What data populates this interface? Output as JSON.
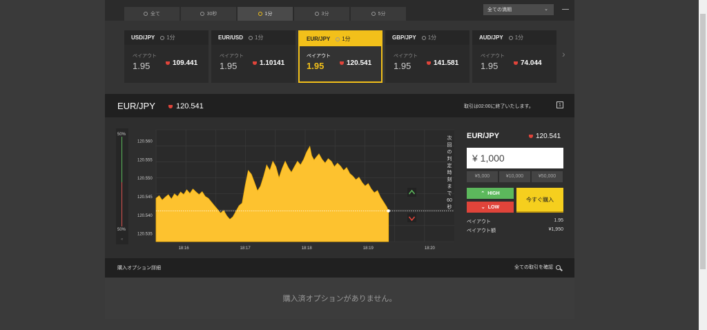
{
  "tabs": [
    {
      "label": "全て",
      "active": false
    },
    {
      "label": "30秒",
      "active": false
    },
    {
      "label": "1分",
      "active": true
    },
    {
      "label": "3分",
      "active": false
    },
    {
      "label": "5分",
      "active": false
    }
  ],
  "account_select": "全ての満期",
  "cards": [
    {
      "pair": "USD/JPY",
      "duration": "1分",
      "payout_label": "ペイアウト",
      "payout": "1.95",
      "price": "109.441"
    },
    {
      "pair": "EUR/USD",
      "duration": "1分",
      "payout_label": "ペイアウト",
      "payout": "1.95",
      "price": "1.10141"
    },
    {
      "pair": "EUR/JPY",
      "duration": "1分",
      "payout_label": "ペイアウト",
      "payout": "1.95",
      "price": "120.541"
    },
    {
      "pair": "GBP/JPY",
      "duration": "1分",
      "payout_label": "ペイアウト",
      "payout": "1.95",
      "price": "141.581"
    },
    {
      "pair": "AUD/JPY",
      "duration": "1分",
      "payout_label": "ペイアウト",
      "payout": "1.95",
      "price": "74.044"
    }
  ],
  "pairbar": {
    "name": "EUR/JPY",
    "price": "120.541",
    "end_message": "取引は02:00に終了いたします。",
    "cal_icon": "1"
  },
  "gauge": {
    "top": "50%",
    "bottom": "50%",
    "reset": "«"
  },
  "chart_data": {
    "type": "area",
    "y_ticks": [
      "120.560",
      "120.555",
      "120.550",
      "120.545",
      "120.540",
      "120.535"
    ],
    "y_values": [
      120.56,
      120.555,
      120.55,
      120.545,
      120.54,
      120.535
    ],
    "ylim": [
      120.5328,
      120.563
    ],
    "x_ticks": [
      "18:16",
      "18:17",
      "18:18",
      "18:19",
      "18:20"
    ],
    "x_tick_min": [
      16,
      17,
      18,
      19,
      20
    ],
    "xlim": [
      15.55,
      20.4
    ],
    "series": [
      {
        "values": [
          [
            15.55,
            120.5445
          ],
          [
            15.6,
            120.5452
          ],
          [
            15.65,
            120.544
          ],
          [
            15.7,
            120.5448
          ],
          [
            15.75,
            120.5455
          ],
          [
            15.8,
            120.5443
          ],
          [
            15.85,
            120.5457
          ],
          [
            15.9,
            120.545
          ],
          [
            15.95,
            120.5462
          ],
          [
            16.0,
            120.5455
          ],
          [
            16.05,
            120.5468
          ],
          [
            16.1,
            120.5458
          ],
          [
            16.15,
            120.547
          ],
          [
            16.2,
            120.5462
          ],
          [
            16.25,
            120.5455
          ],
          [
            16.3,
            120.5463
          ],
          [
            16.35,
            120.545
          ],
          [
            16.4,
            120.5445
          ],
          [
            16.45,
            120.5435
          ],
          [
            16.5,
            120.5425
          ],
          [
            16.55,
            120.5415
          ],
          [
            16.6,
            120.5405
          ],
          [
            16.65,
            120.5412
          ],
          [
            16.7,
            120.5398
          ],
          [
            16.75,
            120.5388
          ],
          [
            16.8,
            120.5395
          ],
          [
            16.85,
            120.541
          ],
          [
            16.9,
            120.5425
          ],
          [
            16.95,
            120.5432
          ],
          [
            17.0,
            120.548
          ],
          [
            17.05,
            120.552
          ],
          [
            17.1,
            120.551
          ],
          [
            17.15,
            120.5488
          ],
          [
            17.2,
            120.5465
          ],
          [
            17.25,
            120.5478
          ],
          [
            17.3,
            120.5505
          ],
          [
            17.35,
            120.5535
          ],
          [
            17.4,
            120.552
          ],
          [
            17.45,
            120.5545
          ],
          [
            17.5,
            120.553
          ],
          [
            17.55,
            120.55
          ],
          [
            17.6,
            120.5525
          ],
          [
            17.65,
            120.5545
          ],
          [
            17.7,
            120.5528
          ],
          [
            17.75,
            120.5515
          ],
          [
            17.8,
            120.553
          ],
          [
            17.85,
            120.5545
          ],
          [
            17.9,
            120.5535
          ],
          [
            17.95,
            120.555
          ],
          [
            18.0,
            120.557
          ],
          [
            18.05,
            120.5585
          ],
          [
            18.08,
            120.556
          ],
          [
            18.12,
            120.5548
          ],
          [
            18.15,
            120.5555
          ],
          [
            18.2,
            120.5565
          ],
          [
            18.25,
            120.555
          ],
          [
            18.3,
            120.554
          ],
          [
            18.35,
            120.5552
          ],
          [
            18.4,
            120.5545
          ],
          [
            18.45,
            120.553
          ],
          [
            18.5,
            120.554
          ],
          [
            18.55,
            120.5532
          ],
          [
            18.6,
            120.552
          ],
          [
            18.65,
            120.5528
          ],
          [
            18.7,
            120.5512
          ],
          [
            18.75,
            120.5505
          ],
          [
            18.8,
            120.5495
          ],
          [
            18.85,
            120.5502
          ],
          [
            18.9,
            120.5488
          ],
          [
            18.95,
            120.5478
          ],
          [
            19.0,
            120.5485
          ],
          [
            19.05,
            120.547
          ],
          [
            19.1,
            120.546
          ],
          [
            19.15,
            120.5466
          ],
          [
            19.2,
            120.5448
          ],
          [
            19.25,
            120.5435
          ],
          [
            19.3,
            120.5422
          ],
          [
            19.33,
            120.5411
          ]
        ]
      }
    ],
    "current_price": 120.5411,
    "countdown_label": "次回の判定時刻まで",
    "countdown": "60",
    "countdown_unit": "秒"
  },
  "trade": {
    "pair": "EUR/JPY",
    "price": "120.541",
    "amount": "¥ 1,000",
    "quick_amounts": [
      "¥5,000",
      "¥10,000",
      "¥50,000"
    ],
    "high_label": "HIGH",
    "low_label": "LOW",
    "buy_label": "今すぐ購入",
    "payout_label": "ペイアウト",
    "payout_value": "1.95",
    "payout_amount_label": "ペイアウト額",
    "payout_amount_value": "¥1,950"
  },
  "details": {
    "title": "購入オプション詳細",
    "all_trades": "全ての取引を確認",
    "empty_message": "購入済オプションがありません。"
  },
  "colors": {
    "accent": "#f2c01a",
    "high": "#5cb85c",
    "low": "#e0443a"
  }
}
